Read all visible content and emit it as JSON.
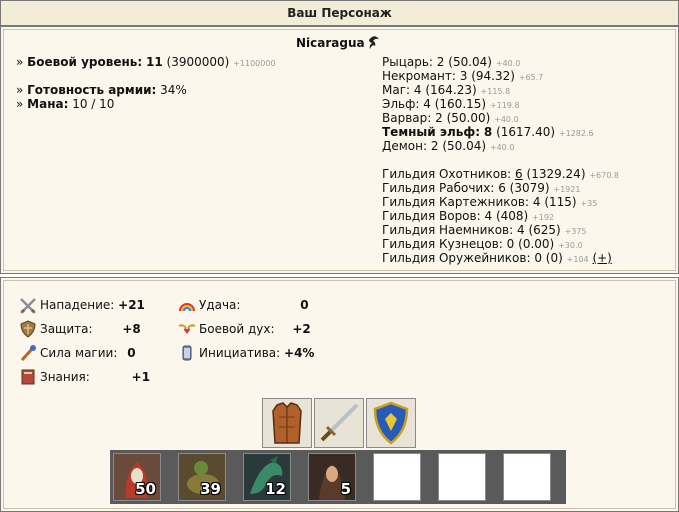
{
  "header": {
    "title": "Ваш Персонаж"
  },
  "character": {
    "name": "Nicaragua",
    "combat_level_label": "Боевой уровень:",
    "combat_level": "11",
    "combat_exp": "(3900000)",
    "combat_exp_next": "+1100000",
    "army_ready_label": "Готовность армии:",
    "army_ready": "34%",
    "mana_label": "Мана:",
    "mana": "10 / 10"
  },
  "factions": [
    {
      "name": "Рыцарь:",
      "level": "2",
      "points": "(50.04)",
      "next": "+40.0"
    },
    {
      "name": "Некромант:",
      "level": "3",
      "points": "(94.32)",
      "next": "+65.7"
    },
    {
      "name": "Маг:",
      "level": "4",
      "points": "(164.23)",
      "next": "+115.8"
    },
    {
      "name": "Эльф:",
      "level": "4",
      "points": "(160.15)",
      "next": "+119.8"
    },
    {
      "name": "Варвар:",
      "level": "2",
      "points": "(50.00)",
      "next": "+40.0"
    },
    {
      "name": "Темный эльф:",
      "level": "8",
      "points": "(1617.40)",
      "next": "+1282.6"
    },
    {
      "name": "Демон:",
      "level": "2",
      "points": "(50.04)",
      "next": "+40.0"
    }
  ],
  "guilds": [
    {
      "name": "Гильдия Охотников:",
      "level": "6",
      "points": "(1329.24)",
      "next": "+670.8"
    },
    {
      "name": "Гильдия Рабочих:",
      "level": "6",
      "points": "(3079)",
      "next": "+1921"
    },
    {
      "name": "Гильдия Картежников:",
      "level": "4",
      "points": "(115)",
      "next": "+35"
    },
    {
      "name": "Гильдия Воров:",
      "level": "4",
      "points": "(408)",
      "next": "+192"
    },
    {
      "name": "Гильдия Наемников:",
      "level": "4",
      "points": "(625)",
      "next": "+375"
    },
    {
      "name": "Гильдия Кузнецов:",
      "level": "0",
      "points": "(0.00)",
      "next": "+30.0"
    },
    {
      "name": "Гильдия Оружейников:",
      "level": "0",
      "points": "(0)",
      "next": "+104",
      "extra": "(+)"
    }
  ],
  "stats_left": [
    {
      "label": "Нападение:",
      "value": "+21",
      "icon": "swords-icon"
    },
    {
      "label": "Защита:",
      "value": "+8",
      "icon": "shield-icon"
    },
    {
      "label": "Сила магии:",
      "value": "0",
      "icon": "magic-wand-icon"
    },
    {
      "label": "Знания:",
      "value": "+1",
      "icon": "book-icon"
    }
  ],
  "stats_right": [
    {
      "label": "Удача:",
      "value": "0",
      "icon": "rainbow-icon"
    },
    {
      "label": "Боевой дух:",
      "value": "+2",
      "icon": "winged-heart-icon"
    },
    {
      "label": "Инициатива:",
      "value": "+4%",
      "icon": "hourglass-icon"
    }
  ],
  "equipment": [
    {
      "name": "leather-armor"
    },
    {
      "name": "sword"
    },
    {
      "name": "knight-shield"
    }
  ],
  "army": [
    {
      "creature": "hooded-mage",
      "count": "50"
    },
    {
      "creature": "lizard-rider",
      "count": "39"
    },
    {
      "creature": "green-dragon",
      "count": "12"
    },
    {
      "creature": "dark-elf-sorceress",
      "count": "5"
    },
    {
      "creature": "",
      "count": ""
    },
    {
      "creature": "",
      "count": ""
    },
    {
      "creature": "",
      "count": ""
    }
  ]
}
